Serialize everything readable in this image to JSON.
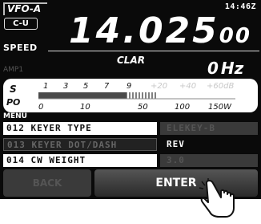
{
  "status": {
    "vfo": "VFO-A",
    "mode": "C-U",
    "clock": "14:46Z",
    "speed_label": "SPEED",
    "amp_label": "AMP1"
  },
  "frequency": {
    "main": "14.025",
    "sub": "00"
  },
  "clarifier": {
    "label": "CLAR",
    "value": "0",
    "unit": "Hz"
  },
  "meter": {
    "s_label": "S",
    "po_label": "PO",
    "s_scale": [
      "1",
      "3",
      "5",
      "7",
      "9",
      "+20",
      "+40",
      "+60dB"
    ],
    "po_scale": [
      "0",
      "10",
      "50",
      "100",
      "150W"
    ],
    "level_fraction": 0.6
  },
  "menu": {
    "header": "MENU",
    "items": [
      {
        "label": "012 KEYER TYPE",
        "value": "ELEKEY-B"
      },
      {
        "label": "013 KEYER DOT/DASH",
        "value": "REV"
      },
      {
        "label": "014 CW WEIGHT",
        "value": "3.0"
      }
    ]
  },
  "buttons": {
    "back": "BACK",
    "enter": "ENTER"
  }
}
